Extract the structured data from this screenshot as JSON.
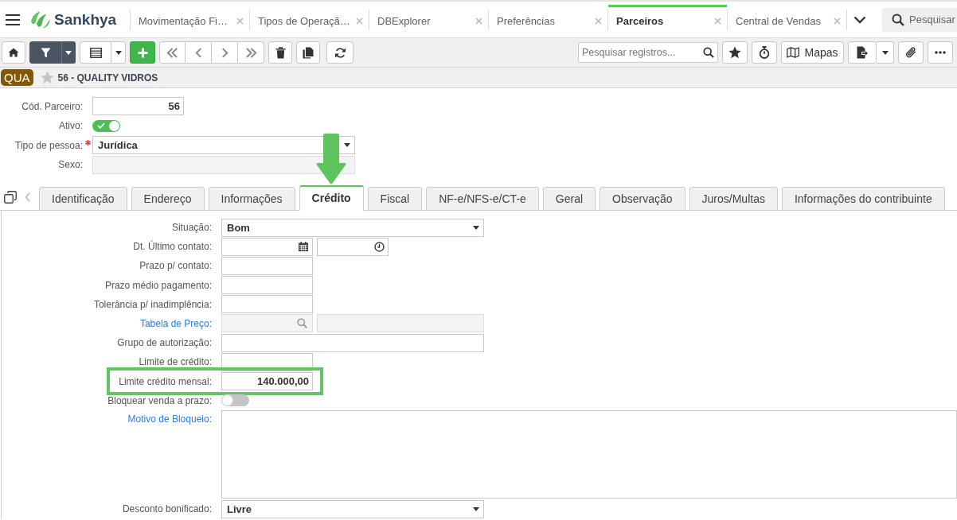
{
  "app_bar": {
    "brand": "Sankhya",
    "tabs": [
      {
        "label": "Movimentação Fi…",
        "selected": false
      },
      {
        "label": "Tipos de Operaçã…",
        "selected": false
      },
      {
        "label": "DBExplorer",
        "selected": false
      },
      {
        "label": "Preferências",
        "selected": false
      },
      {
        "label": "Parceiros",
        "selected": true
      },
      {
        "label": "Central de Vendas",
        "selected": false
      }
    ],
    "search": {
      "placeholder": "Pesquisar"
    }
  },
  "toolbar": {
    "filter_active": true,
    "search": {
      "placeholder": "Pesquisar registros..."
    },
    "maps_button": "Mapas"
  },
  "record": {
    "badge": "QUA",
    "favorite": false,
    "title": "56 - QUALITY VIDROS"
  },
  "header_fields": [
    {
      "kind": "number",
      "label": "Cód. Parceiro:",
      "value": "56",
      "required": false,
      "disabled": false
    },
    {
      "kind": "toggle",
      "label": "Ativo:",
      "on": true,
      "required": false,
      "disabled": false
    },
    {
      "kind": "select",
      "label": "Tipo de pessoa:",
      "value": "Jurídica",
      "required": true,
      "disabled": false
    },
    {
      "kind": "select",
      "label": "Sexo:",
      "required": false,
      "disabled": true
    }
  ],
  "form_tabs": [
    {
      "label": "Identificação",
      "selected": false,
      "highlighted": false
    },
    {
      "label": "Endereço",
      "selected": false,
      "highlighted": false
    },
    {
      "label": "Informações",
      "selected": false,
      "highlighted": false
    },
    {
      "label": "Crédito",
      "selected": true,
      "highlighted": true
    },
    {
      "label": "Fiscal",
      "selected": false,
      "highlighted": false
    },
    {
      "label": "NF-e/NFS-e/CT-e",
      "selected": false,
      "highlighted": false
    },
    {
      "label": "Geral",
      "selected": false,
      "highlighted": false
    },
    {
      "label": "Observação",
      "selected": false,
      "highlighted": false
    },
    {
      "label": "Juros/Multas",
      "selected": false,
      "highlighted": false
    },
    {
      "label": "Informações do contribuinte",
      "selected": false,
      "highlighted": false
    }
  ],
  "credit_form": {
    "fields": [
      {
        "kind": "select",
        "label": "Situação:",
        "value": "Bom",
        "link": false,
        "disabled": false,
        "highlighted": false
      },
      {
        "kind": "datetime",
        "label": "Dt. Último contato:",
        "link": false,
        "disabled": false,
        "highlighted": false
      },
      {
        "kind": "short",
        "label": "Prazo p/ contato:",
        "link": false,
        "disabled": false,
        "highlighted": false
      },
      {
        "kind": "short",
        "label": "Prazo médio pagamento:",
        "link": false,
        "disabled": false,
        "highlighted": false
      },
      {
        "kind": "short",
        "label": "Tolerância p/ inadimplência:",
        "link": false,
        "disabled": false,
        "highlighted": false
      },
      {
        "kind": "lookup",
        "label": "Tabela de Preço:",
        "link": true,
        "disabled": true,
        "highlighted": false
      },
      {
        "kind": "wide",
        "label": "Grupo de autorização:",
        "link": false,
        "disabled": false,
        "highlighted": false
      },
      {
        "kind": "short",
        "label": "Limite de crédito:",
        "link": false,
        "disabled": false,
        "highlighted": false
      },
      {
        "kind": "short",
        "label": "Limite crédito mensal:",
        "value": "140.000,00",
        "link": false,
        "disabled": false,
        "highlighted": true
      },
      {
        "kind": "toggle",
        "label": "Bloquear venda a prazo:",
        "on": false,
        "link": false,
        "disabled": false,
        "highlighted": false
      },
      {
        "kind": "memo",
        "label": "Motivo de Bloqueio:",
        "link": true,
        "disabled": false,
        "highlighted": false
      },
      {
        "kind": "select",
        "label": "Desconto bonificado:",
        "value": "Livre",
        "link": false,
        "disabled": false,
        "highlighted": false
      }
    ]
  }
}
